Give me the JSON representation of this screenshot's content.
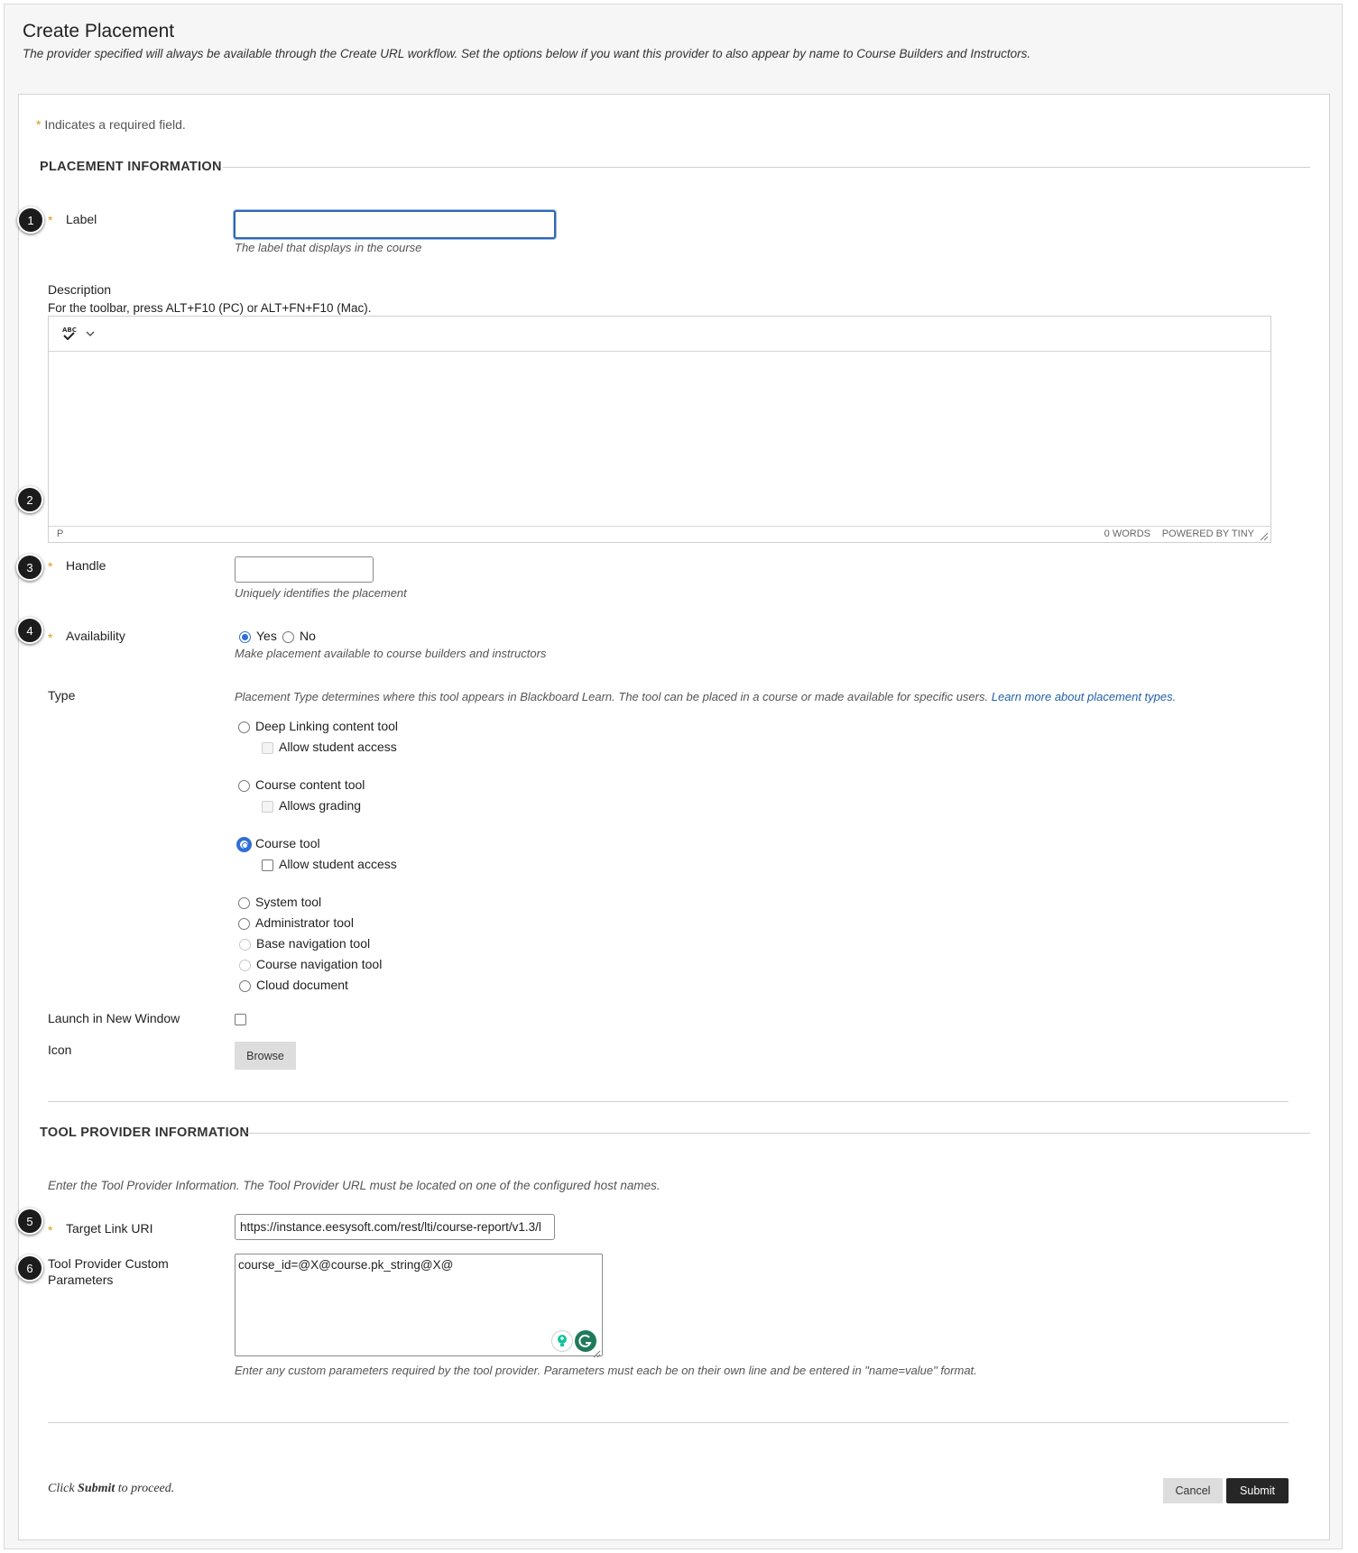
{
  "header": {
    "title": "Create Placement",
    "subtitle": "The provider specified will always be available through the Create URL workflow. Set the options below if you want this provider to also appear by name to Course Builders and Instructors."
  },
  "required_note": {
    "star": "*",
    "text": "Indicates a required field."
  },
  "placement_section": {
    "title": "PLACEMENT INFORMATION",
    "label_field": {
      "label": "Label",
      "value": "",
      "help": "The label that displays in the course"
    },
    "description": {
      "label": "Description",
      "toolbar_hint": "For the toolbar, press ALT+F10 (PC) or ALT+FN+F10 (Mac).",
      "spellcheck_icon": "spellcheck-icon",
      "path": "P",
      "word_count": "0 WORDS",
      "powered_by": "POWERED BY TINY"
    },
    "handle_field": {
      "label": "Handle",
      "value": "",
      "help": "Uniquely identifies the placement"
    },
    "availability": {
      "label": "Availability",
      "yes": "Yes",
      "no": "No",
      "selected": "Yes",
      "help": "Make placement available to course builders and instructors"
    },
    "type": {
      "label": "Type",
      "help": "Placement Type determines where this tool appears in Blackboard Learn. The tool can be placed in a course or made available for specific users.",
      "help_link": "Learn more about placement types.",
      "options": {
        "deep_linking": "Deep Linking content tool",
        "deep_linking_sub": "Allow student access",
        "course_content": "Course content tool",
        "course_content_sub": "Allows grading",
        "course_tool": "Course tool",
        "course_tool_sub": "Allow student access",
        "system_tool": "System tool",
        "admin_tool": "Administrator tool",
        "base_nav": "Base navigation tool",
        "course_nav": "Course navigation tool",
        "cloud_doc": "Cloud document"
      },
      "selected": "Course tool"
    },
    "launch_new_window": {
      "label": "Launch in New Window",
      "checked": false
    },
    "icon_field": {
      "label": "Icon",
      "browse_label": "Browse"
    }
  },
  "tool_provider_section": {
    "title": "TOOL PROVIDER INFORMATION",
    "intro": "Enter the Tool Provider Information. The Tool Provider URL must be located on one of the configured host names.",
    "target_link": {
      "label": "Target Link URI",
      "value": "https://instance.eesysoft.com/rest/lti/course-report/v1.3/l"
    },
    "custom_params": {
      "label_line1": "Tool Provider Custom",
      "label_line2": "Parameters",
      "value": "course_id=@X@course.pk_string@X@",
      "help": "Enter any custom parameters required by the tool provider. Parameters must each be on their own line and be entered in \"name=value\" format."
    }
  },
  "footer": {
    "hint_prefix": "Click ",
    "hint_bold": "Submit",
    "hint_suffix": " to proceed.",
    "cancel_label": "Cancel",
    "submit_label": "Submit"
  },
  "callouts": [
    "1",
    "2",
    "3",
    "4",
    "5",
    "6"
  ],
  "colors": {
    "accent": "#2e65b3",
    "required_star": "#e2951a",
    "link": "#2360a6",
    "submit_bg": "#262626"
  }
}
